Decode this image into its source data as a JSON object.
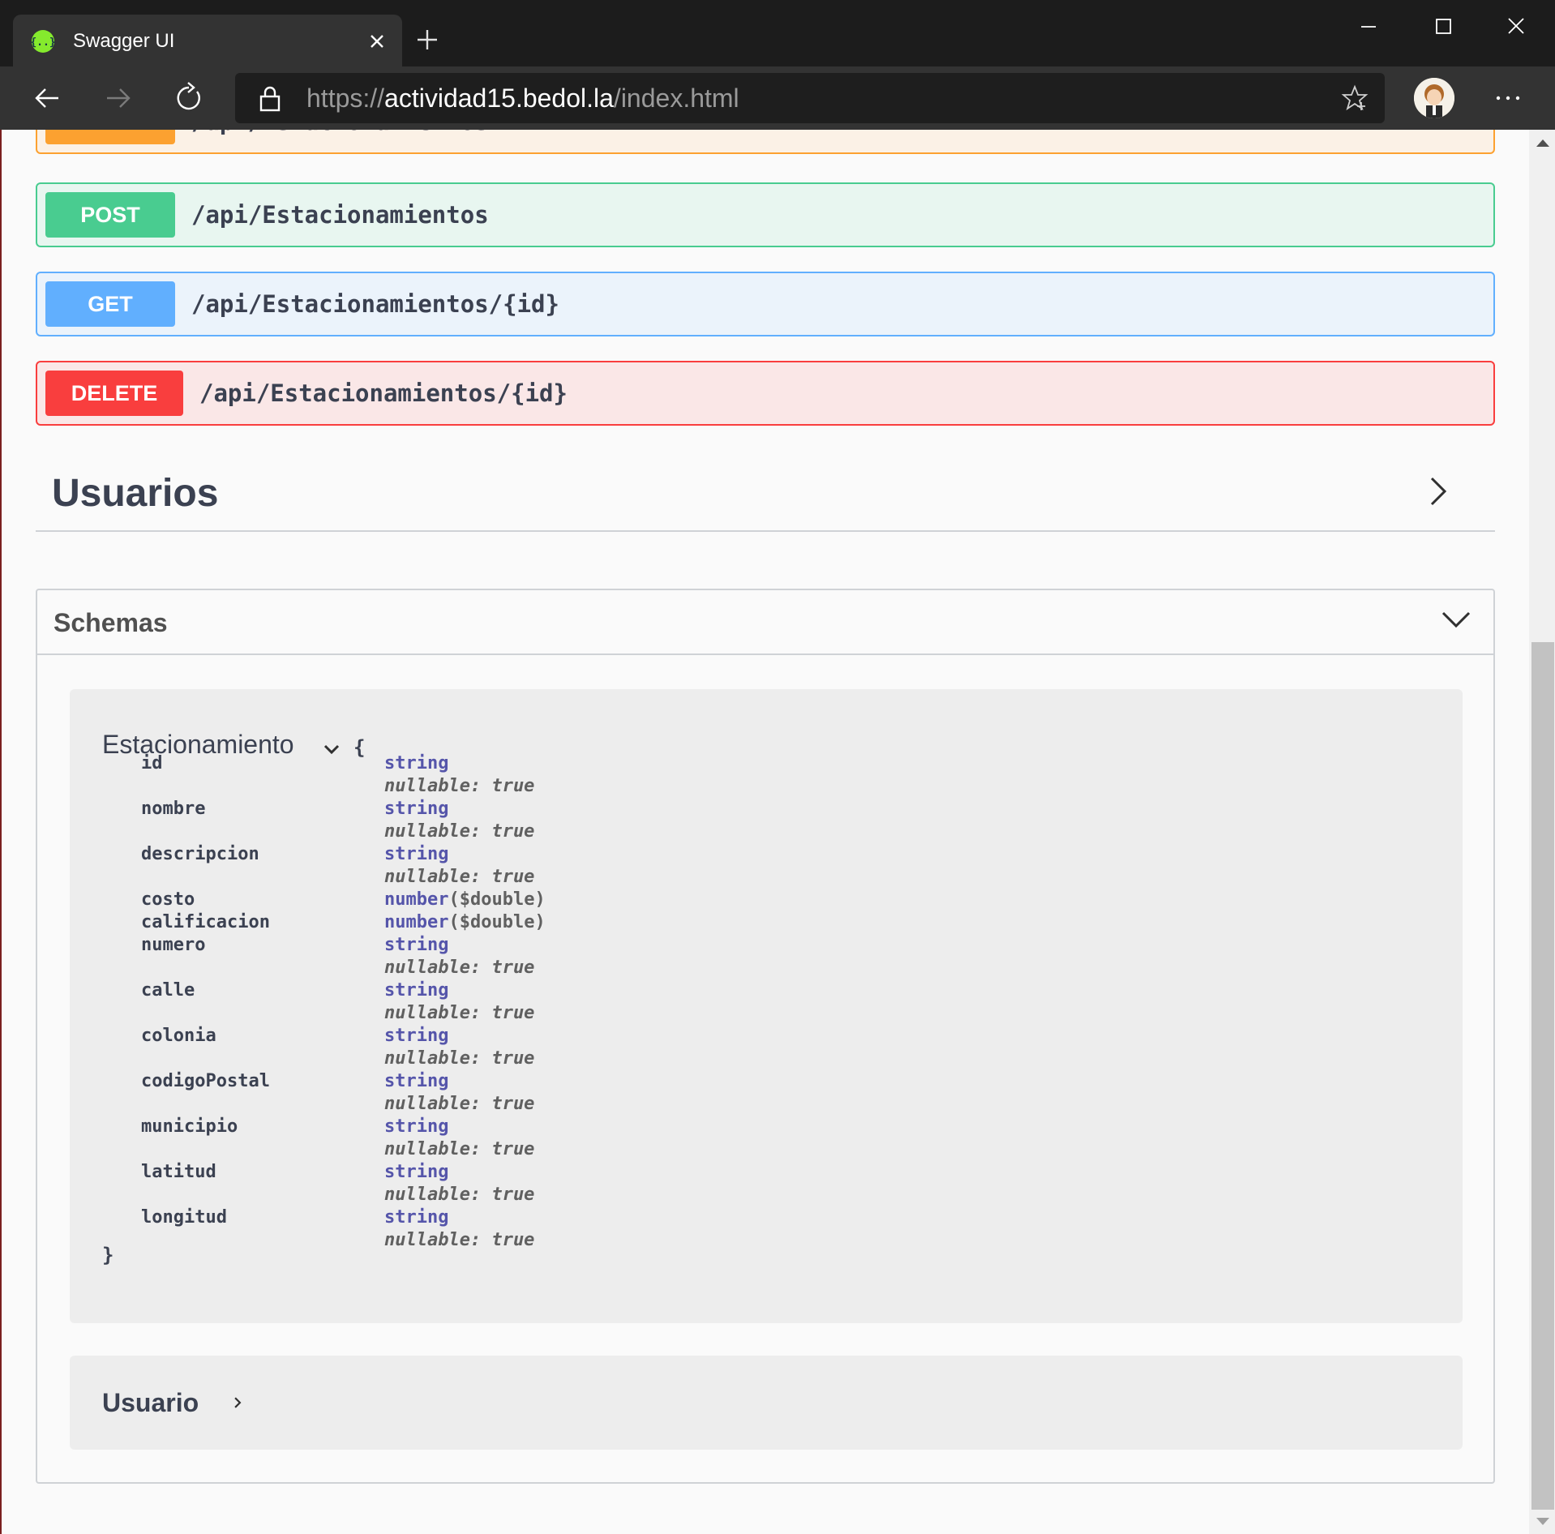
{
  "browser": {
    "tab_title": "Swagger UI",
    "url_scheme": "https://",
    "url_host": "actividad15.bedol.la",
    "url_path": "/index.html"
  },
  "operations": [
    {
      "method": "PUT",
      "path": "/api/Estacionamientos",
      "color": "#fca130"
    },
    {
      "method": "POST",
      "path": "/api/Estacionamientos",
      "color": "#49cc90"
    },
    {
      "method": "GET",
      "path": "/api/Estacionamientos/{id}",
      "color": "#61affe"
    },
    {
      "method": "DELETE",
      "path": "/api/Estacionamientos/{id}",
      "color": "#f93e3e"
    }
  ],
  "tag": {
    "title": "Usuarios"
  },
  "schemas": {
    "title": "Schemas",
    "estacionamiento": {
      "name": "Estacionamiento",
      "open_brace": "{",
      "close_brace": "}",
      "properties": [
        {
          "name": "id",
          "type": "string",
          "format": "",
          "nullable": "nullable: true"
        },
        {
          "name": "nombre",
          "type": "string",
          "format": "",
          "nullable": "nullable: true"
        },
        {
          "name": "descripcion",
          "type": "string",
          "format": "",
          "nullable": "nullable: true"
        },
        {
          "name": "costo",
          "type": "number",
          "format": "($double)",
          "nullable": ""
        },
        {
          "name": "calificacion",
          "type": "number",
          "format": "($double)",
          "nullable": ""
        },
        {
          "name": "numero",
          "type": "string",
          "format": "",
          "nullable": "nullable: true"
        },
        {
          "name": "calle",
          "type": "string",
          "format": "",
          "nullable": "nullable: true"
        },
        {
          "name": "colonia",
          "type": "string",
          "format": "",
          "nullable": "nullable: true"
        },
        {
          "name": "codigoPostal",
          "type": "string",
          "format": "",
          "nullable": "nullable: true"
        },
        {
          "name": "municipio",
          "type": "string",
          "format": "",
          "nullable": "nullable: true"
        },
        {
          "name": "latitud",
          "type": "string",
          "format": "",
          "nullable": "nullable: true"
        },
        {
          "name": "longitud",
          "type": "string",
          "format": "",
          "nullable": "nullable: true"
        }
      ]
    },
    "usuario": {
      "name": "Usuario"
    }
  }
}
